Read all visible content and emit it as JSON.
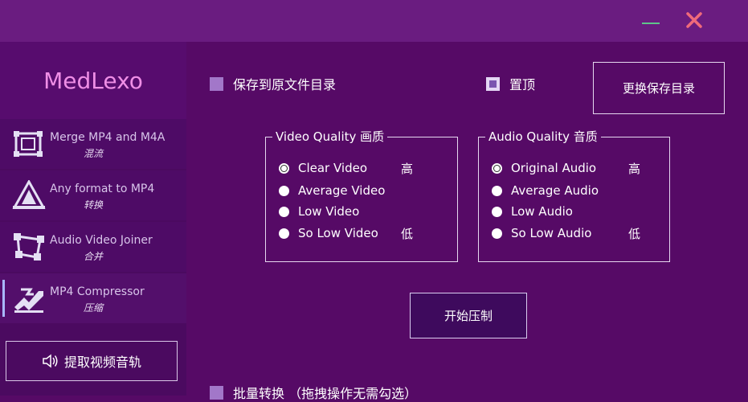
{
  "app": {
    "title": "MedLexo"
  },
  "window": {
    "minimize_icon": "minimize-icon",
    "close_icon": "close-icon",
    "close_color": "#f06a7a"
  },
  "sidebar": {
    "items": [
      {
        "label": "Merge MP4 and M4A",
        "sub": "混流",
        "icon": "merge-icon"
      },
      {
        "label": "Any format to MP4",
        "sub": "转换",
        "icon": "convert-icon"
      },
      {
        "label": "Audio Video Joiner",
        "sub": "合并",
        "icon": "joiner-icon"
      },
      {
        "label": "MP4 Compressor",
        "sub": "压缩",
        "icon": "compressor-icon",
        "active": true
      }
    ],
    "extract_button": "提取视频音轨"
  },
  "main": {
    "save_to_original": {
      "label": "保存到原文件目录",
      "checked": false
    },
    "pin_top": {
      "label": "置顶",
      "checked": true
    },
    "change_dir_button": "更换保存目录",
    "video_quality": {
      "title": "Video Quality 画质",
      "options": [
        {
          "label": "Clear Video",
          "tag": "高",
          "selected": true
        },
        {
          "label": "Average Video",
          "tag": ""
        },
        {
          "label": "Low Video",
          "tag": ""
        },
        {
          "label": "So Low Video",
          "tag": "低"
        }
      ]
    },
    "audio_quality": {
      "title": "Audio Quality 音质",
      "options": [
        {
          "label": "Original Audio",
          "tag": "高",
          "selected": true
        },
        {
          "label": "Average Audio",
          "tag": ""
        },
        {
          "label": "Low Audio",
          "tag": ""
        },
        {
          "label": "So Low Audio",
          "tag": "低"
        }
      ]
    },
    "start_button": "开始压制",
    "batch": {
      "label": "批量转换 （拖拽操作无需勾选）",
      "checked": false
    }
  },
  "colors": {
    "background": "#560a66",
    "sidebar": "#4b0a60",
    "titlebar": "#6a1c80",
    "brand": "#ef8ee6"
  }
}
